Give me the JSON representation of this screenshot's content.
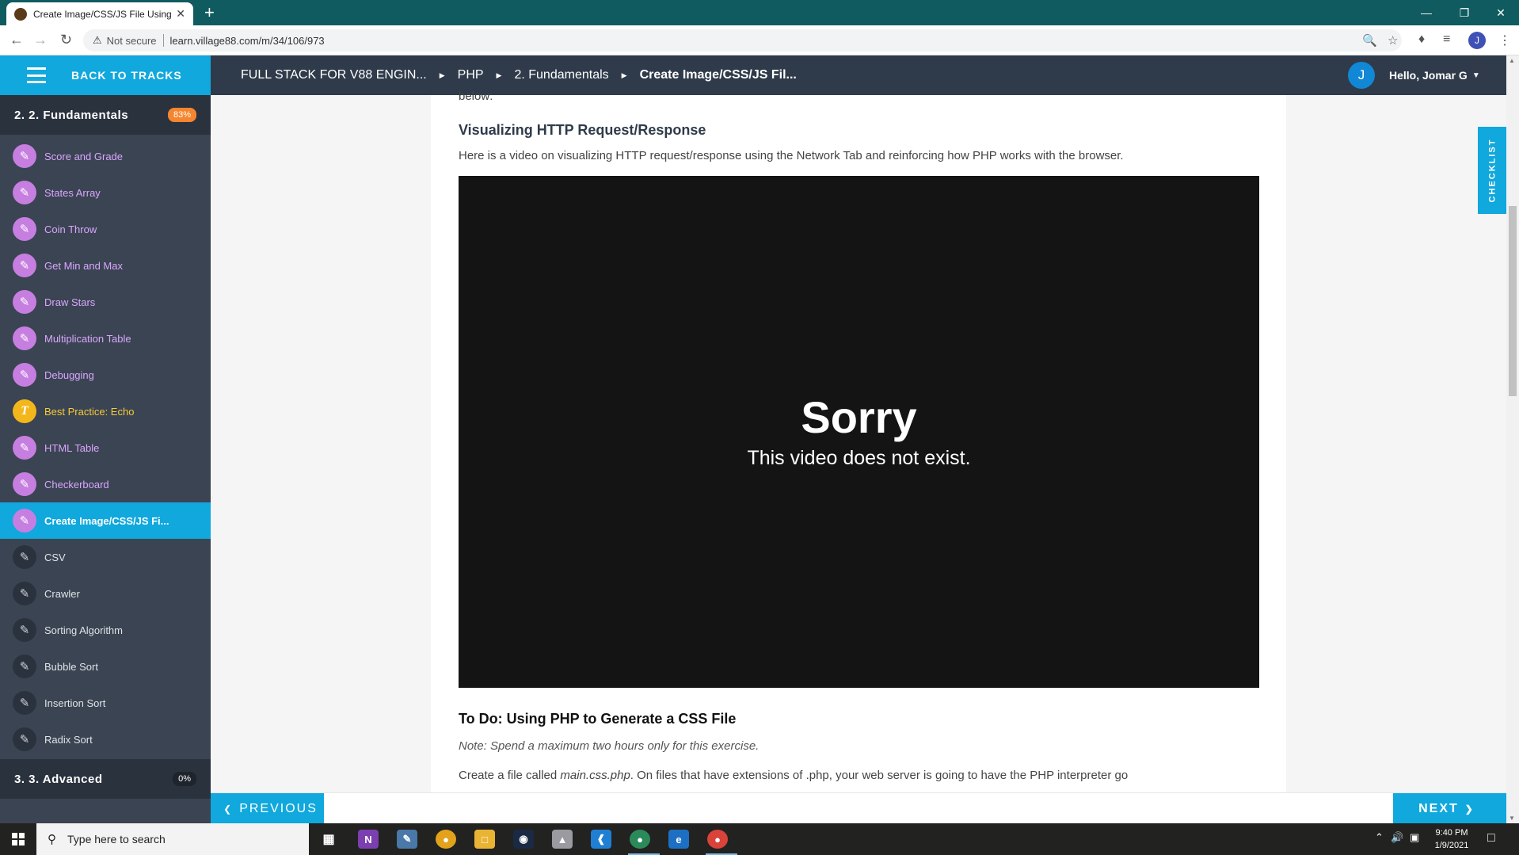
{
  "browser": {
    "tab_title": "Create Image/CSS/JS File Using P",
    "tab_close": "✕",
    "new_tab": "+",
    "not_secure": "Not secure",
    "url": "learn.village88.com/m/34/106/973",
    "profile_initial": "J"
  },
  "header": {
    "back_to_tracks": "BACK TO TRACKS",
    "breadcrumb": [
      "FULL STACK FOR V88 ENGIN...",
      "PHP",
      "2. Fundamentals",
      "Create Image/CSS/JS Fil..."
    ],
    "user_initial": "J",
    "greeting": "Hello, Jomar G"
  },
  "sidebar": {
    "section": {
      "label": "2. 2. Fundamentals",
      "progress": "83%"
    },
    "items": [
      {
        "label": "Score and Grade",
        "status": "done"
      },
      {
        "label": "States Array",
        "status": "done"
      },
      {
        "label": "Coin Throw",
        "status": "done"
      },
      {
        "label": "Get Min and Max",
        "status": "done"
      },
      {
        "label": "Draw Stars",
        "status": "done"
      },
      {
        "label": "Multiplication Table",
        "status": "done"
      },
      {
        "label": "Debugging",
        "status": "done"
      },
      {
        "label": "Best Practice: Echo",
        "status": "text"
      },
      {
        "label": "HTML Table",
        "status": "done"
      },
      {
        "label": "Checkerboard",
        "status": "done"
      },
      {
        "label": "Create Image/CSS/JS Fi...",
        "status": "active"
      },
      {
        "label": "CSV",
        "status": "todo"
      },
      {
        "label": "Crawler",
        "status": "todo"
      },
      {
        "label": "Sorting Algorithm",
        "status": "todo"
      },
      {
        "label": "Bubble Sort",
        "status": "todo"
      },
      {
        "label": "Insertion Sort",
        "status": "todo"
      },
      {
        "label": "Radix Sort",
        "status": "todo"
      }
    ],
    "next_section": {
      "label": "3. 3. Advanced",
      "progress": "0%"
    }
  },
  "content": {
    "below_text": "below:",
    "heading_visualizing": "Visualizing HTTP Request/Response",
    "paragraph_visualizing": "Here is a video on visualizing HTTP request/response using the Network Tab and reinforcing how PHP works with the browser.",
    "video": {
      "title": "Sorry",
      "message": "This video does not exist."
    },
    "heading_todo": "To Do: Using PHP to Generate a CSS File",
    "note": "Note: Spend a maximum two hours only for this exercise.",
    "create_prefix": "Create a file called ",
    "create_filename": "main.css.php",
    "create_suffix": ". On files that have extensions of .php, your web server is going to have the PHP interpreter go"
  },
  "checklist_label": "CHECKLIST",
  "nav": {
    "previous": "PREVIOUS",
    "next": "NEXT"
  },
  "taskbar": {
    "search_placeholder": "Type here to search",
    "time": "9:40 PM",
    "date": "1/9/2021"
  },
  "colors": {
    "accent": "#10a8dd",
    "header_bg": "#2f3b4a",
    "sidebar_bg": "#3b4452",
    "done_icon": "#c67ee0",
    "badge": "#f5852e"
  }
}
